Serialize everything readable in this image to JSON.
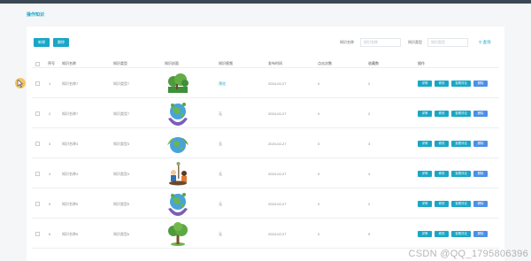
{
  "app": {
    "page_title": "操作知识"
  },
  "toolbar": {
    "add_label": "新增",
    "delete_label": "删除"
  },
  "filters": {
    "name_label": "知识名称",
    "name_placeholder": "知识名称",
    "type_label": "知识类型",
    "type_placeholder": "知识类型",
    "search_label": "查询"
  },
  "table": {
    "headers": [
      "序号",
      "知识名称",
      "知识类型",
      "知识封面",
      "知识视频",
      "发布时间",
      "点击次数",
      "收藏数",
      "操作"
    ],
    "actions": {
      "detail": "详情",
      "edit": "修改",
      "comments": "查看评论",
      "delete": "删除"
    },
    "rows": [
      {
        "index": "1",
        "name": "知识名称7",
        "type": "知识类型7",
        "video": "预览",
        "date": "2024-02-27",
        "clicks": "0",
        "favorites": "2",
        "cover": "park-icon"
      },
      {
        "index": "2",
        "name": "知识名称7",
        "type": "知识类型7",
        "video": "无",
        "date": "2024-02-27",
        "clicks": "0",
        "favorites": "2",
        "cover": "earth-hands-icon"
      },
      {
        "index": "3",
        "name": "知识名称3",
        "type": "知识类型3",
        "video": "无",
        "date": "2024-02-27",
        "clicks": "0",
        "favorites": "3",
        "cover": "earth-leaves-icon"
      },
      {
        "index": "4",
        "name": "知识名称4",
        "type": "知识类型4",
        "video": "无",
        "date": "2024-02-27",
        "clicks": "0",
        "favorites": "4",
        "cover": "planting-tree-icon"
      },
      {
        "index": "5",
        "name": "知识名称5",
        "type": "知识类型5",
        "video": "无",
        "date": "2024-02-27",
        "clicks": "0",
        "favorites": "2",
        "cover": "earth-hands-icon"
      },
      {
        "index": "6",
        "name": "知识名称6",
        "type": "知识类型6",
        "video": "无",
        "date": "2024-02-27",
        "clicks": "0",
        "favorites": "9",
        "cover": "tree-icon"
      }
    ]
  },
  "watermark": "CSDN @QQ_1795806396",
  "colors": {
    "accent": "#1aa6c6",
    "blue": "#4c8fe6",
    "topbar": "#3b4754"
  }
}
